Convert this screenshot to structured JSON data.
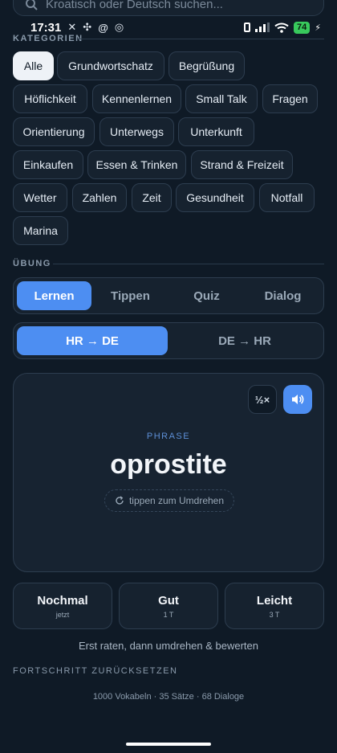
{
  "search": {
    "placeholder": "Kroatisch oder Deutsch suchen..."
  },
  "status_bar": {
    "time": "17:31",
    "battery": "74"
  },
  "sections": {
    "categories": "KATEGORIEN",
    "exercise": "ÜBUNG"
  },
  "categories": [
    "Alle",
    "Grundwortschatz",
    "Begrüßung",
    "Höflichkeit",
    "Kennenlernen",
    "Small Talk",
    "Fragen",
    "Orientierung",
    "Unterwegs",
    "Unterkunft",
    "Einkaufen",
    "Essen & Trinken",
    "Strand & Freizeit",
    "Wetter",
    "Zahlen",
    "Zeit",
    "Gesundheit",
    "Notfall",
    "Marina"
  ],
  "active_category": "Alle",
  "modes": [
    "Lernen",
    "Tippen",
    "Quiz",
    "Dialog"
  ],
  "active_mode": "Lernen",
  "directions": [
    "HR → DE",
    "DE → HR"
  ],
  "active_direction": "HR → DE",
  "card": {
    "speed_label": "½×",
    "type": "PHRASE",
    "word": "oprostite",
    "flip_hint": "tippen zum Umdrehen"
  },
  "ratings": [
    {
      "title": "Nochmal",
      "sub": "jetzt"
    },
    {
      "title": "Gut",
      "sub": "1 T"
    },
    {
      "title": "Leicht",
      "sub": "3 T"
    }
  ],
  "hint": "Erst raten, dann umdrehen & bewerten",
  "reset_label": "FORTSCHRITT ZURÜCKSETZEN",
  "footer": "1000 Vokabeln · 35 Sätze · 68 Dialoge",
  "colors": {
    "accent": "#4d8ef2",
    "background": "#0f1a26",
    "surface": "#16222f"
  }
}
